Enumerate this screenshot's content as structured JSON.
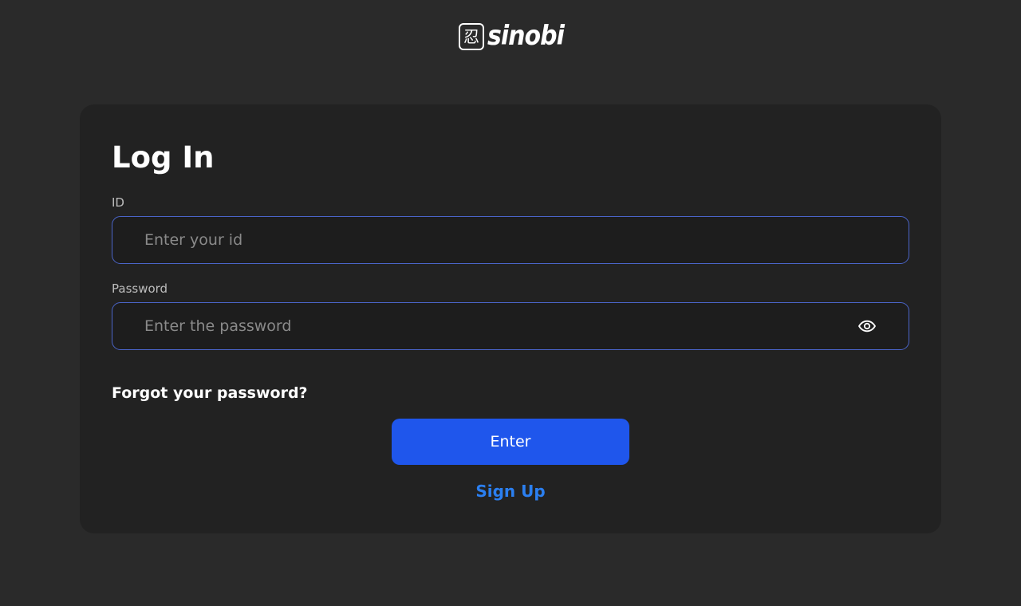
{
  "brand": {
    "mark_glyph": "忍",
    "name": "sinobi"
  },
  "login": {
    "title": "Log In",
    "id_label": "ID",
    "id_placeholder": "Enter your id",
    "id_value": "",
    "password_label": "Password",
    "password_placeholder": "Enter the password",
    "password_value": "",
    "toggle_icon": "eye-icon",
    "forgot_link": "Forgot your password?",
    "submit_label": "Enter",
    "signup_link": "Sign Up"
  },
  "colors": {
    "background": "#2a2a2a",
    "card": "#222222",
    "input_border": "#4a64c8",
    "primary_button": "#1f56ec",
    "link": "#2b7ff0"
  }
}
